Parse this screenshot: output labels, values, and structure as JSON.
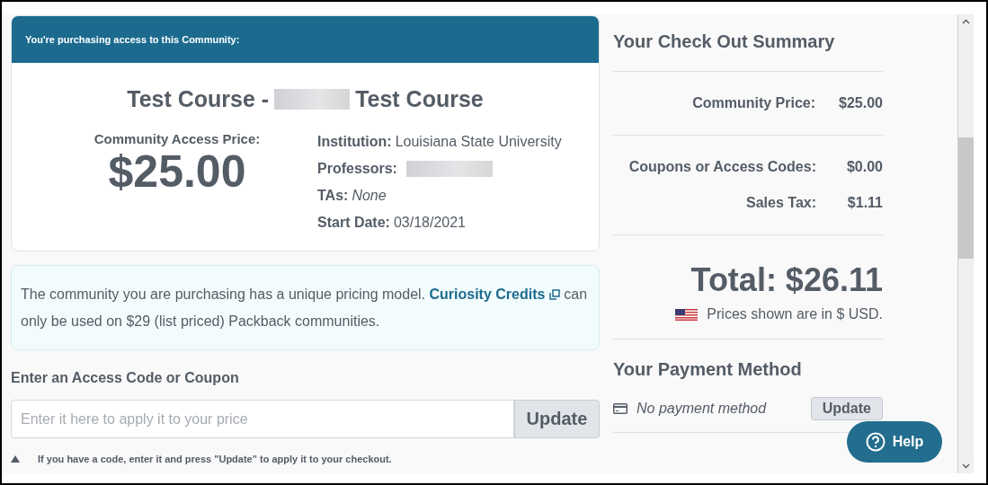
{
  "purchase_card": {
    "header": "You're purchasing access to this Community:",
    "title_before": "Test Course -",
    "title_after": "Test Course",
    "price_label": "Community Access Price:",
    "price": "$25.00",
    "details": [
      {
        "label": "Institution:",
        "kind": "text",
        "value": "Louisiana State University"
      },
      {
        "label": "Professors:",
        "kind": "redacted"
      },
      {
        "label": "TAs:",
        "kind": "italic",
        "value": "None"
      },
      {
        "label": "Start Date:",
        "kind": "text",
        "value": "03/18/2021"
      }
    ]
  },
  "notice": {
    "before": "The community you are purchasing has a unique pricing model.",
    "link": "Curiosity Credits",
    "after": "can only be used on $29 (list priced) Packback communities."
  },
  "coupon": {
    "label": "Enter an Access Code or Coupon",
    "placeholder": "Enter it here to apply it to your price",
    "button": "Update",
    "hint": "If you have a code, enter it and press \"Update\" to apply it to your checkout."
  },
  "summary": {
    "title": "Your Check Out Summary",
    "groups": [
      [
        {
          "label": "Community Price:",
          "value": "$25.00"
        }
      ],
      [
        {
          "label": "Coupons or Access Codes:",
          "value": "$0.00"
        },
        {
          "label": "Sales Tax:",
          "value": "$1.11"
        }
      ]
    ],
    "total": "Total: $26.11",
    "currency_note": "Prices shown are in $ USD."
  },
  "payment": {
    "title": "Your Payment Method",
    "method": "No payment method",
    "button": "Update"
  },
  "help_button": "Help"
}
